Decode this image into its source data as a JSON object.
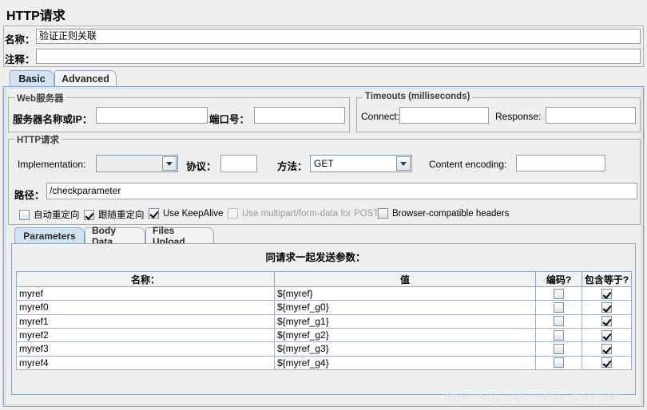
{
  "window": {
    "title": "HTTP请求"
  },
  "fields": {
    "name_label": "名称：",
    "name_value": "验证正则关联",
    "comment_label": "注释：",
    "comment_value": ""
  },
  "tabs": [
    {
      "label": "Basic",
      "selected": true
    },
    {
      "label": "Advanced",
      "selected": false
    }
  ],
  "web_server": {
    "group_title": "Web服务器",
    "server_label": "服务器名称或IP：",
    "server_value": "",
    "port_label": "端口号：",
    "port_value": ""
  },
  "timeouts": {
    "group_title": "Timeouts (milliseconds)",
    "connect_label": "Connect:",
    "connect_value": "",
    "response_label": "Response:",
    "response_value": ""
  },
  "http_request": {
    "group_title": "HTTP请求",
    "implementation_label": "Implementation:",
    "implementation_value": "",
    "protocol_label": "协议：",
    "protocol_value": "",
    "method_label": "方法：",
    "method_value": "GET",
    "content_encoding_label": "Content encoding:",
    "content_encoding_value": "",
    "path_label": "路径：",
    "path_value": "/checkparameter"
  },
  "options": [
    {
      "label": "自动重定向",
      "checked": false,
      "disabled": false
    },
    {
      "label": "跟随重定向",
      "checked": true,
      "disabled": false
    },
    {
      "label": "Use KeepAlive",
      "checked": true,
      "disabled": false
    },
    {
      "label": "Use multipart/form-data for POST",
      "checked": false,
      "disabled": true
    },
    {
      "label": "Browser-compatible headers",
      "checked": false,
      "disabled": false
    }
  ],
  "inner_tabs": [
    {
      "label": "Parameters",
      "selected": true
    },
    {
      "label": "Body Data",
      "selected": false
    },
    {
      "label": "Files Upload",
      "selected": false
    }
  ],
  "params": {
    "caption": "同请求一起发送参数：",
    "columns": [
      "名称：",
      "值",
      "编码?",
      "包含等于?"
    ],
    "rows": [
      {
        "name": "myref",
        "value": "${myref}",
        "encode": false,
        "include_equals": true
      },
      {
        "name": "myref0",
        "value": "${myref_g0}",
        "encode": false,
        "include_equals": true
      },
      {
        "name": "myref1",
        "value": "${myref_g1}",
        "encode": false,
        "include_equals": true
      },
      {
        "name": "myref2",
        "value": "${myref_g2}",
        "encode": false,
        "include_equals": true
      },
      {
        "name": "myref3",
        "value": "${myref_g3}",
        "encode": false,
        "include_equals": true
      },
      {
        "name": "myref4",
        "value": "${myref_g4}",
        "encode": false,
        "include_equals": true
      }
    ]
  },
  "watermark": {
    "text": "https://blog.csdn.net/qq_40531382"
  }
}
